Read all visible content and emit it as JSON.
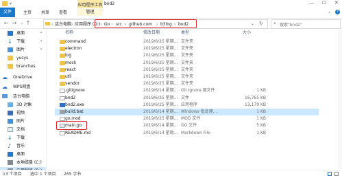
{
  "window": {
    "title": "bnd2",
    "context_group": "应用程序工具"
  },
  "ribbon": {
    "tabs": [
      "文件",
      "主页",
      "共享",
      "查看",
      "管理"
    ]
  },
  "address": {
    "crumbs": [
      "这台电脑",
      "应用程序 (D:)",
      "Go",
      "src",
      "github.com",
      "b3log",
      "bnd2"
    ],
    "search_placeholder": "搜索\"bnd2\""
  },
  "nav": {
    "items": [
      {
        "label": "桌面",
        "icon": "desktop-icon",
        "pinned": true
      },
      {
        "label": "下载",
        "icon": "download-icon",
        "pinned": true
      },
      {
        "label": "图片",
        "icon": "pictures-icon",
        "pinned": true
      },
      {
        "label": "yusys",
        "icon": "folder-icon"
      },
      {
        "label": "branches",
        "icon": "folder-icon"
      },
      {
        "label": "OneDrive",
        "icon": "onedrive-icon"
      },
      {
        "label": "WPS网盘",
        "icon": "wps-cloud-icon"
      },
      {
        "label": "这台电脑",
        "icon": "computer-icon"
      },
      {
        "label": "3D 对象",
        "icon": "3d-objects-icon"
      },
      {
        "label": "视频",
        "icon": "video-icon"
      },
      {
        "label": "图片",
        "icon": "pictures-icon"
      },
      {
        "label": "文档",
        "icon": "documents-icon"
      },
      {
        "label": "下载",
        "icon": "download-icon"
      },
      {
        "label": "音乐",
        "icon": "music-icon"
      },
      {
        "label": "桌面",
        "icon": "desktop-icon"
      },
      {
        "label": "本地磁盘 (C:)",
        "icon": "drive-icon"
      },
      {
        "label": "应用程序 (D:)",
        "icon": "drive-icon"
      }
    ]
  },
  "columns": {
    "name": "名称",
    "date": "修改日期",
    "type": "类型",
    "size": "大小"
  },
  "files": [
    {
      "name": "command",
      "date": "2019/6/25 星期...",
      "type": "文件夹",
      "size": "",
      "icon": "folder-icon"
    },
    {
      "name": "electron",
      "date": "2019/6/25 星期...",
      "type": "文件夹",
      "size": "",
      "icon": "folder-icon"
    },
    {
      "name": "log",
      "date": "2019/6/25 星期...",
      "type": "文件夹",
      "size": "",
      "icon": "folder-icon"
    },
    {
      "name": "mock",
      "date": "2019/6/25 星期...",
      "type": "文件夹",
      "size": "",
      "icon": "folder-icon"
    },
    {
      "name": "react",
      "date": "2019/6/25 星期...",
      "type": "文件夹",
      "size": "",
      "icon": "folder-icon"
    },
    {
      "name": "util",
      "date": "2019/6/25 星期...",
      "type": "文件夹",
      "size": "",
      "icon": "folder-icon"
    },
    {
      "name": "vendor",
      "date": "2019/6/25 星期...",
      "type": "文件夹",
      "size": "",
      "icon": "folder-icon"
    },
    {
      "name": ".gitignore",
      "date": "2019/6/14 星期...",
      "type": "Git Ignore 源文件",
      "size": "1 KB",
      "icon": "file-icon"
    },
    {
      "name": "bnd2",
      "date": "2019/6/25 星期...",
      "type": "文件",
      "size": "16,765 KB",
      "icon": "file-icon"
    },
    {
      "name": "bnd2.exe",
      "date": "2019/6/25 星期...",
      "type": "应用程序",
      "size": "13,179 KB",
      "icon": "exe-icon"
    },
    {
      "name": "build.bat",
      "date": "2019/6/14 星期...",
      "type": "Windows 批处理...",
      "size": "1 KB",
      "icon": "bat-icon",
      "selected": true
    },
    {
      "name": "go.mod",
      "date": "2019/6/25 星期...",
      "type": "MOD 文件",
      "size": "1 KB",
      "icon": "file-icon"
    },
    {
      "name": "main.go",
      "date": "2019/6/14 星期...",
      "type": "GO 文件",
      "size": "5 KB",
      "icon": "go-icon"
    },
    {
      "name": "README.md",
      "date": "2019/6/14 星期...",
      "type": "Markdown File",
      "size": "1 KB",
      "icon": "file-icon"
    }
  ],
  "status": {
    "count": "13 个项目",
    "selected": "选中 1 个项目",
    "size": "265 字节"
  },
  "colors": {
    "accent": "#1979ca",
    "selection": "#cce8ff",
    "highlight": "#e0262b",
    "context": "#fde9a5"
  }
}
